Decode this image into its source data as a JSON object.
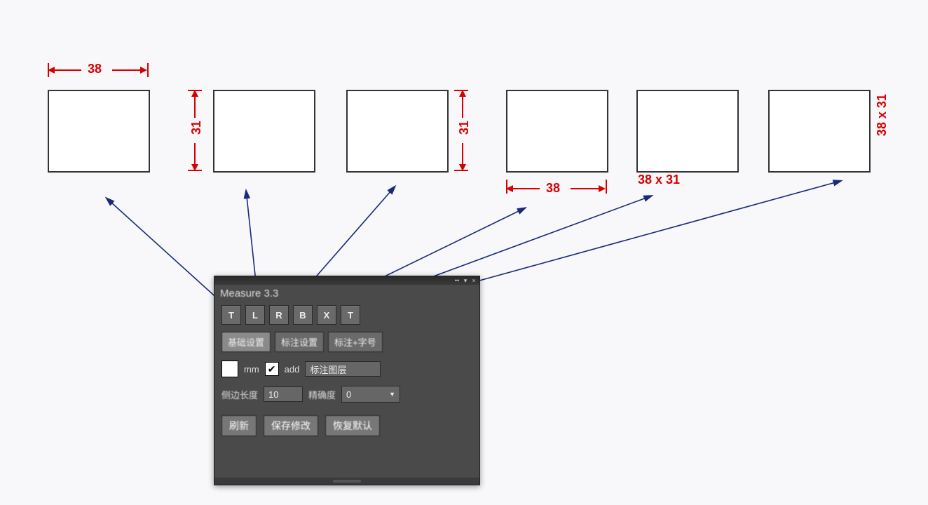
{
  "dimension_color": "#d60000",
  "callout_color": "#1a2a7a",
  "rects": {
    "width_label": "38",
    "height_label": "31",
    "combo_label": "38 x 31"
  },
  "panel": {
    "title": "Measure 3.3",
    "toolButtons": [
      "T",
      "L",
      "R",
      "B",
      "X",
      "T"
    ],
    "tabs": {
      "items": [
        "基础设置",
        "标注设置",
        "标注+字号"
      ],
      "activeIndex": 0
    },
    "unitRow": {
      "unit_label": "mm",
      "add_checked": true,
      "add_label": "add",
      "layer_value": "标注图层"
    },
    "optionsRow": {
      "sidelen_label": "侧边长度",
      "sidelen_value": "10",
      "precision_label": "精确度",
      "precision_value": "0"
    },
    "actions": {
      "refresh": "刷新",
      "save": "保存修改",
      "reset": "恢复默认"
    }
  }
}
